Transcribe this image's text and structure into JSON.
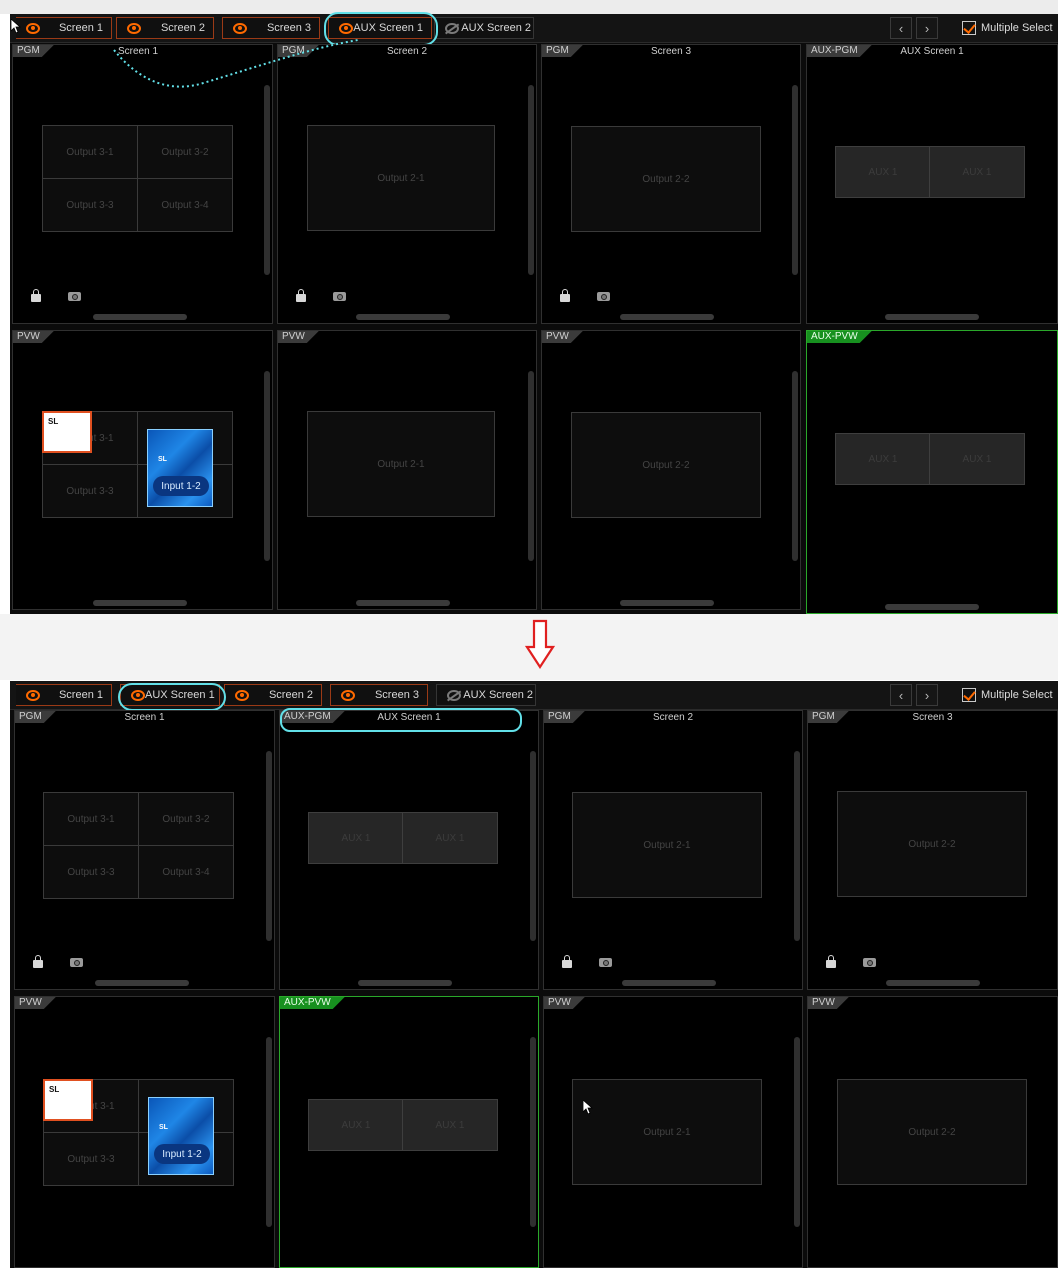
{
  "top": {
    "tabs": [
      {
        "label": "Screen 1",
        "eye": true
      },
      {
        "label": "Screen 2",
        "eye": true
      },
      {
        "label": "Screen 3",
        "eye": true
      },
      {
        "label": "AUX Screen 1",
        "eye": true
      },
      {
        "label": "AUX Screen 2",
        "eye": false
      }
    ],
    "multi_select_label": "Multiple Select",
    "nav_prev": "‹",
    "nav_next": "›",
    "pgm_row": [
      {
        "tag": "PGM",
        "title": "Screen 1"
      },
      {
        "tag": "PGM",
        "title": "Screen 2"
      },
      {
        "tag": "PGM",
        "title": "Screen 3"
      },
      {
        "tag": "AUX-PGM",
        "title": "AUX Screen 1"
      }
    ],
    "pvw_row": [
      {
        "tag": "PVW"
      },
      {
        "tag": "PVW"
      },
      {
        "tag": "PVW"
      },
      {
        "tag": "AUX-PVW"
      }
    ],
    "screen1_outputs": [
      "Output 3-1",
      "Output 3-2",
      "Output 3-3",
      "Output 3-4"
    ],
    "screen1_pvw_outputs": [
      "Output 3-1",
      "Output 3-3"
    ],
    "screen2_output": "Output 2-1",
    "screen3_output": "Output 2-2",
    "aux_outputs": [
      "AUX 1",
      "AUX 1"
    ],
    "sl_label": "SL",
    "blue_layer_sl": "SL",
    "blue_layer_label": "Input 1-2"
  },
  "bottom": {
    "tabs": [
      {
        "label": "Screen 1",
        "eye": true
      },
      {
        "label": "AUX Screen 1",
        "eye": true
      },
      {
        "label": "Screen 2",
        "eye": true
      },
      {
        "label": "Screen 3",
        "eye": true
      },
      {
        "label": "AUX Screen 2",
        "eye": false
      }
    ],
    "multi_select_label": "Multiple Select",
    "nav_prev": "‹",
    "nav_next": "›",
    "pgm_row": [
      {
        "tag": "PGM",
        "title": "Screen 1"
      },
      {
        "tag": "AUX-PGM",
        "title": "AUX Screen 1"
      },
      {
        "tag": "PGM",
        "title": "Screen 2"
      },
      {
        "tag": "PGM",
        "title": "Screen 3"
      }
    ],
    "pvw_row": [
      {
        "tag": "PVW"
      },
      {
        "tag": "AUX-PVW"
      },
      {
        "tag": "PVW"
      },
      {
        "tag": "PVW"
      }
    ],
    "screen1_outputs": [
      "Output 3-1",
      "Output 3-2",
      "Output 3-3",
      "Output 3-4"
    ],
    "screen1_pvw_outputs": [
      "Output 3-1",
      "Output 3-3"
    ],
    "aux_outputs": [
      "AUX 1",
      "AUX 1"
    ],
    "screen2_output": "Output 2-1",
    "screen3_output": "Output 2-2",
    "sl_label": "SL",
    "blue_layer_sl": "SL",
    "blue_layer_label": "Input 1-2"
  },
  "colors": {
    "accent_orange": "#ff6a00",
    "highlight_cyan": "#62e0e8",
    "aux_green": "#17901f",
    "arrow_red": "#e02020"
  }
}
